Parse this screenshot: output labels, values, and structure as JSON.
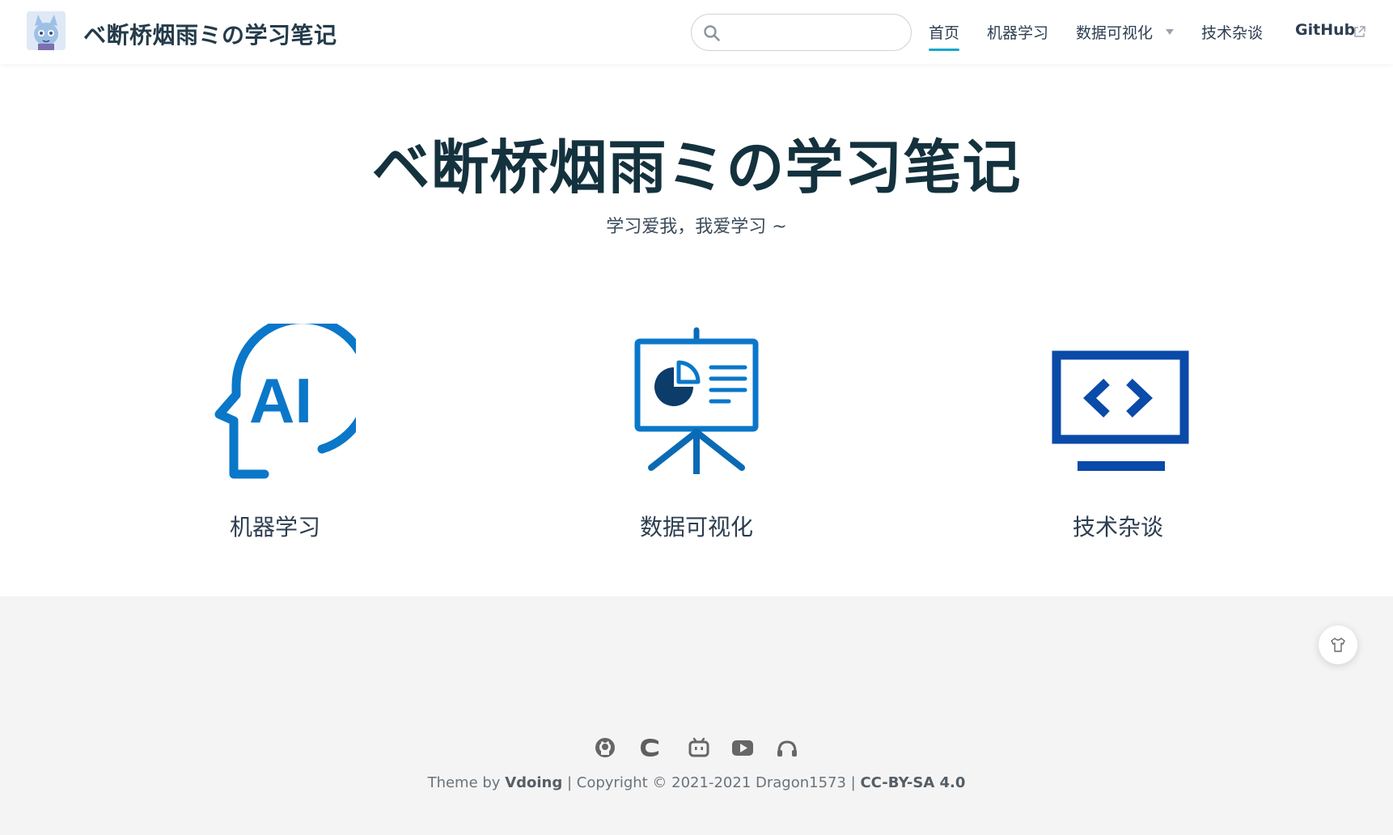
{
  "navbar": {
    "site_name": "ベ断桥烟雨ミの学习笔记",
    "search_placeholder": "",
    "items": [
      {
        "label": "首页"
      },
      {
        "label": "机器学习"
      },
      {
        "label": "数据可视化"
      },
      {
        "label": "技术杂谈"
      },
      {
        "label": "GitHub"
      }
    ]
  },
  "hero": {
    "title": "ベ断桥烟雨ミの学习笔记",
    "description": "学习爱我，我爱学习 ~"
  },
  "features": [
    {
      "label": "机器学习",
      "icon": "ai-head-icon"
    },
    {
      "label": "数据可视化",
      "icon": "presentation-board-icon"
    },
    {
      "label": "技术杂谈",
      "icon": "code-monitor-icon"
    }
  ],
  "footer": {
    "social_icons": [
      "github-icon",
      "csdn-icon",
      "bilibili-icon",
      "youtube-icon",
      "music-icon"
    ],
    "copyright": {
      "prefix": "Theme by ",
      "theme": "Vdoing",
      "middle": " | Copyright © 2021-2021 Dragon1573 | ",
      "license": "CC-BY-SA 4.0"
    }
  },
  "colors": {
    "accent": "#11a8cd",
    "icon_blue": "#0a77c9",
    "icon_dark_blue": "#0a4aa8",
    "title": "#14323e"
  }
}
